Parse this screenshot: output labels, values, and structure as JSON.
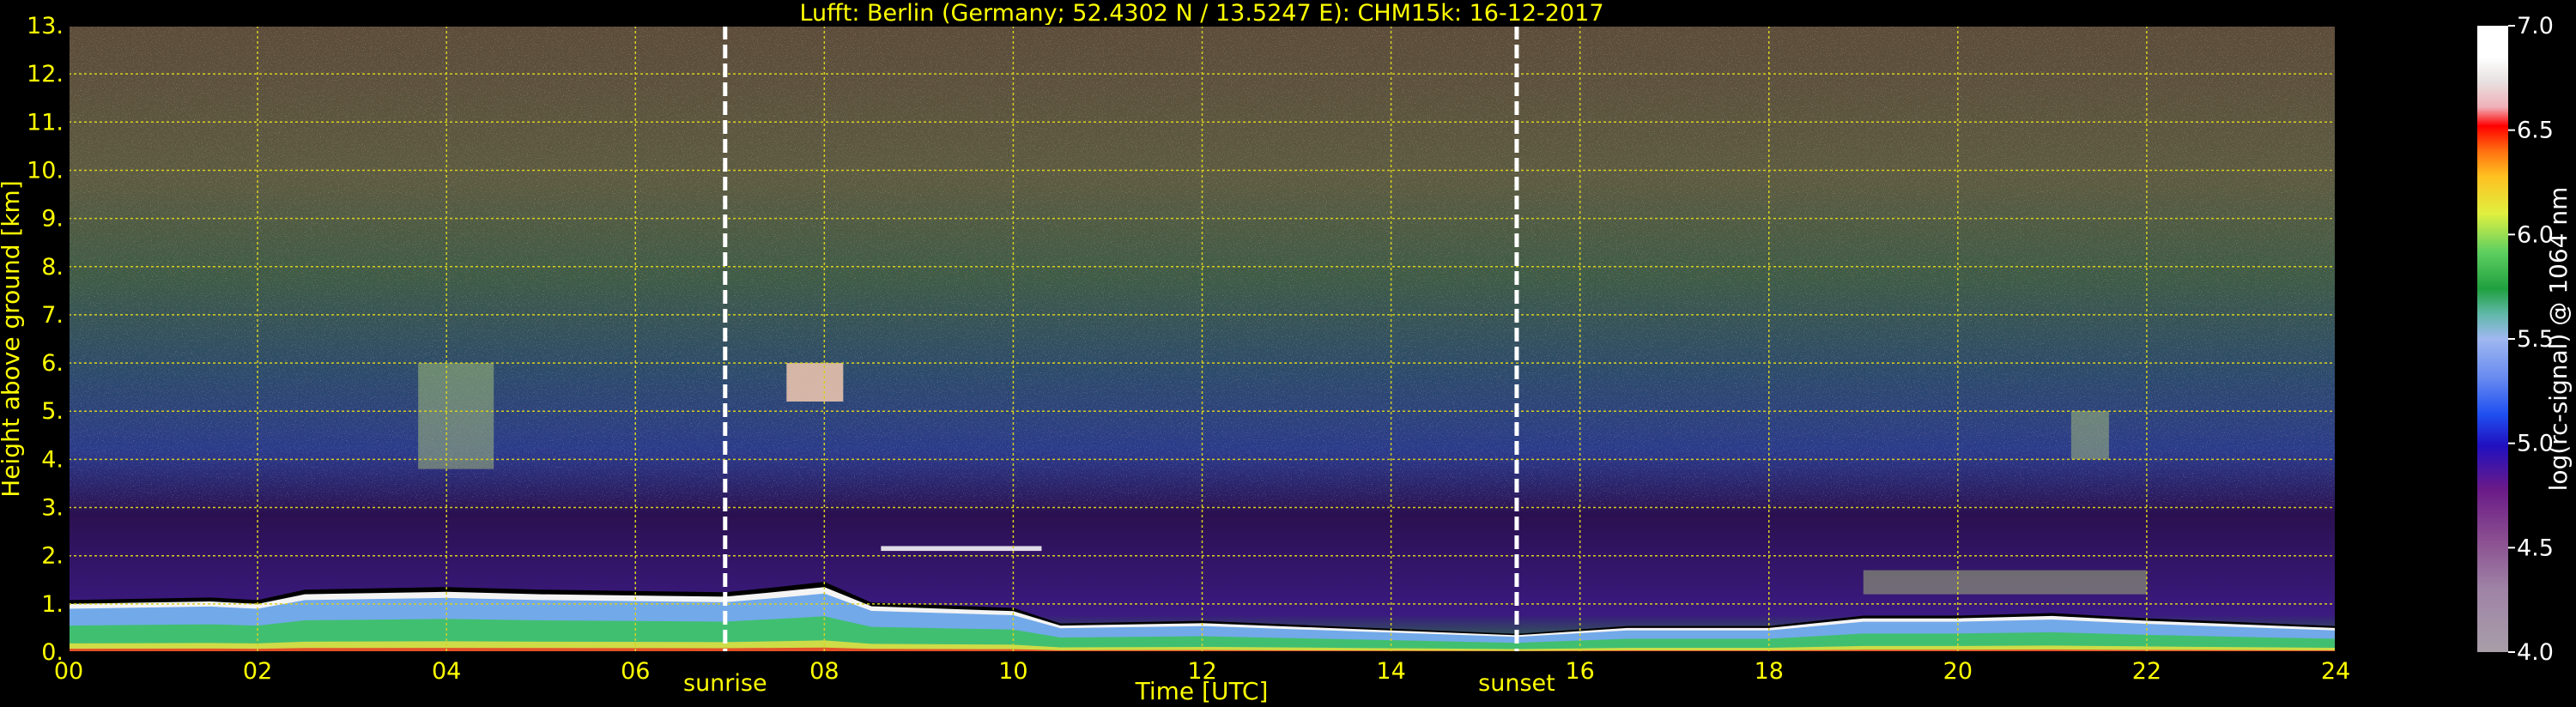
{
  "chart_data": {
    "type": "heatmap",
    "title": "Lufft: Berlin (Germany; 52.4302 N / 13.5247 E):    CHM15k: 16-12-2017",
    "xlabel": "Time [UTC]",
    "ylabel": "Height above ground [km]",
    "xlim": [
      0,
      24
    ],
    "ylim": [
      0,
      13
    ],
    "x_ticks": [
      "00",
      "02",
      "04",
      "06",
      "08",
      "10",
      "12",
      "14",
      "16",
      "18",
      "20",
      "22",
      "24"
    ],
    "y_ticks": [
      "0.",
      "1.",
      "2.",
      "3.",
      "4.",
      "5.",
      "6.",
      "7.",
      "8.",
      "9.",
      "10.",
      "11.",
      "12.",
      "13."
    ],
    "grid": true,
    "colorbar": {
      "label": "log(rc-signal) @ 1064 nm",
      "range": [
        4.0,
        7.0
      ],
      "ticks": [
        "4.0",
        "4.5",
        "5.0",
        "5.5",
        "6.0",
        "6.5",
        "7.0"
      ]
    },
    "annotations": [
      {
        "label": "sunrise",
        "x": 6.95
      },
      {
        "label": "sunset",
        "x": 15.33
      }
    ],
    "boundary_layer_top_km": [
      [
        0.0,
        1.0
      ],
      [
        1.5,
        1.05
      ],
      [
        2.0,
        1.0
      ],
      [
        2.5,
        1.2
      ],
      [
        4.0,
        1.25
      ],
      [
        5.0,
        1.2
      ],
      [
        6.95,
        1.15
      ],
      [
        7.5,
        1.25
      ],
      [
        8.0,
        1.35
      ],
      [
        8.5,
        0.95
      ],
      [
        10.0,
        0.85
      ],
      [
        10.5,
        0.55
      ],
      [
        12.0,
        0.6
      ],
      [
        14.0,
        0.45
      ],
      [
        15.33,
        0.35
      ],
      [
        16.5,
        0.5
      ],
      [
        18.0,
        0.5
      ],
      [
        19.0,
        0.7
      ],
      [
        20.0,
        0.7
      ],
      [
        21.0,
        0.75
      ],
      [
        22.0,
        0.65
      ],
      [
        24.0,
        0.5
      ]
    ],
    "cloud_features": [
      {
        "x_start": 7.6,
        "x_end": 8.2,
        "y_bottom_km": 5.2,
        "y_top_km": 6.0
      },
      {
        "x_start": 8.6,
        "x_end": 10.3,
        "y_bottom_km": 2.1,
        "y_top_km": 2.2
      },
      {
        "x_start": 3.7,
        "x_end": 4.5,
        "y_bottom_km": 3.8,
        "y_top_km": 6.0
      },
      {
        "x_start": 21.2,
        "x_end": 21.6,
        "y_bottom_km": 4.0,
        "y_top_km": 5.0
      },
      {
        "x_start": 19.0,
        "x_end": 22.0,
        "y_bottom_km": 1.2,
        "y_top_km": 1.7
      }
    ]
  }
}
